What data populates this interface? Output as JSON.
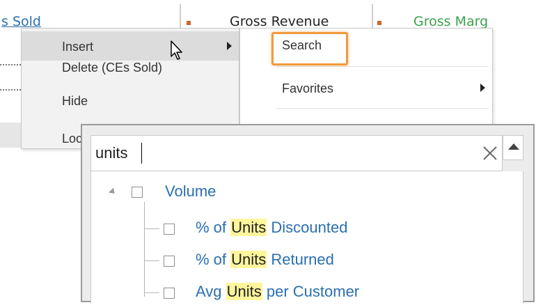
{
  "grid": {
    "columns": [
      {
        "label": "s Sold",
        "color": "#2a6fb0"
      },
      {
        "label": "Gross Revenue",
        "color": "#222222"
      },
      {
        "label": "Gross Marg",
        "color": "#3aa34a"
      }
    ]
  },
  "context_menu": {
    "items": [
      {
        "label": "Insert",
        "has_submenu": true,
        "highlighted": true
      },
      {
        "label": "Delete (CEs Sold)",
        "has_submenu": false
      },
      {
        "label": "Hide",
        "has_submenu": false
      },
      {
        "label": "Loc",
        "has_submenu": false
      }
    ]
  },
  "submenu": {
    "items": [
      {
        "label": "Search",
        "has_submenu": false,
        "annotated": true
      },
      {
        "label": "Favorites",
        "has_submenu": true
      }
    ]
  },
  "search_popup": {
    "query": "units",
    "clear_icon": "close-icon",
    "tree": {
      "group": {
        "label": "Volume",
        "expanded": true,
        "checked": false
      },
      "items": [
        {
          "prefix": "% of ",
          "match": "Units",
          "suffix": " Discounted",
          "checked": false
        },
        {
          "prefix": "% of ",
          "match": "Units",
          "suffix": " Returned",
          "checked": false
        },
        {
          "prefix": "Avg ",
          "match": "Units",
          "suffix": " per Customer",
          "checked": false
        }
      ]
    }
  },
  "colors": {
    "highlight_border": "#f09a3e",
    "match_highlight": "#fff59b",
    "link_blue": "#2a6fb0"
  }
}
